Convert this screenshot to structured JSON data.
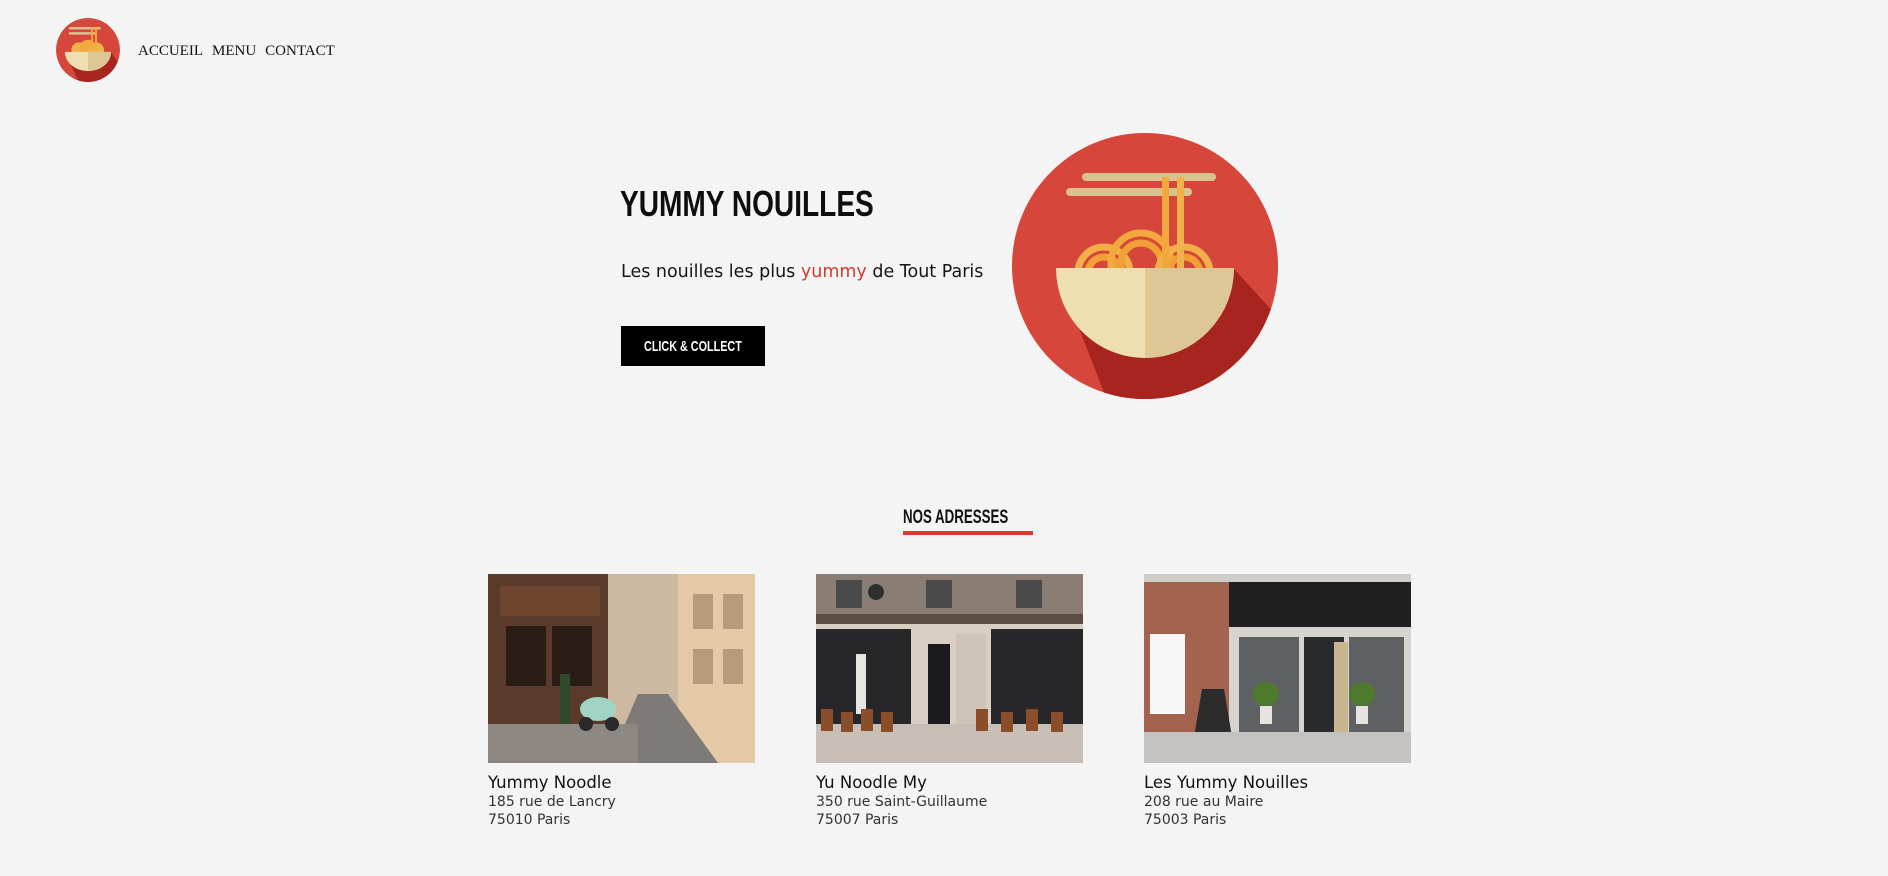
{
  "header": {
    "logo_alt": "Yummy Nouilles logo",
    "nav": [
      {
        "label": "ACCUEIL"
      },
      {
        "label": "MENU"
      },
      {
        "label": "CONTACT"
      }
    ]
  },
  "hero": {
    "title": "YUMMY NOUILLES",
    "subtitle_before": "Les nouilles les plus ",
    "subtitle_accent": "yummy",
    "subtitle_after": " de Tout Paris",
    "cta_label": "CLICK & COLLECT",
    "illustration": "noodle-bowl-icon"
  },
  "addresses": {
    "title": "NOS ADRESSES",
    "items": [
      {
        "name": "Yummy Noodle",
        "street": "185 rue de Lancry",
        "city": "75010 Paris",
        "photo": "storefront-alley-photo"
      },
      {
        "name": "Yu Noodle My",
        "street": "350 rue Saint-Guillaume",
        "city": "75007 Paris",
        "photo": "storefront-terrace-photo"
      },
      {
        "name": "Les Yummy Nouilles",
        "street": "208 rue au Maire",
        "city": "75003 Paris",
        "photo": "storefront-brick-photo"
      }
    ]
  },
  "colors": {
    "background": "#f4f4f4",
    "accent": "#d13b30",
    "button": "#000000",
    "text": "#111111"
  }
}
